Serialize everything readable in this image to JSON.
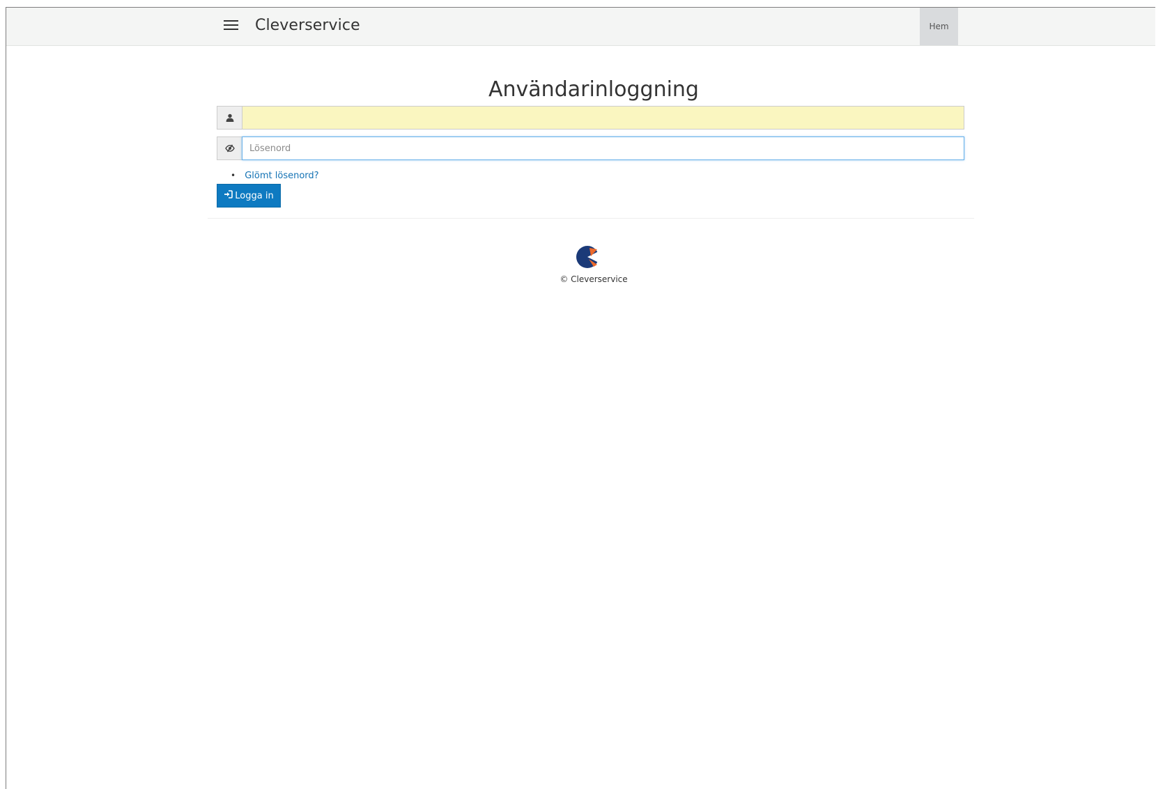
{
  "header": {
    "brand": "Cleverservice",
    "nav_home": "Hem"
  },
  "login": {
    "title": "Användarinloggning",
    "username_value": "",
    "password_placeholder": "Lösenord",
    "forgot_link": "Glömt lösenord?",
    "submit_label": "Logga in"
  },
  "footer": {
    "copyright": "© Cleverservice"
  },
  "icons": {
    "menu": "hamburger-icon",
    "user": "user-icon",
    "password": "eye-slash-icon",
    "login": "sign-in-icon",
    "logo": "cleverservice-logo"
  },
  "colors": {
    "primary": "#0e7ac1",
    "link": "#1372b4",
    "autofill": "#faf6c0",
    "logo_blue": "#1b3a78",
    "logo_orange": "#ec6a2c"
  }
}
